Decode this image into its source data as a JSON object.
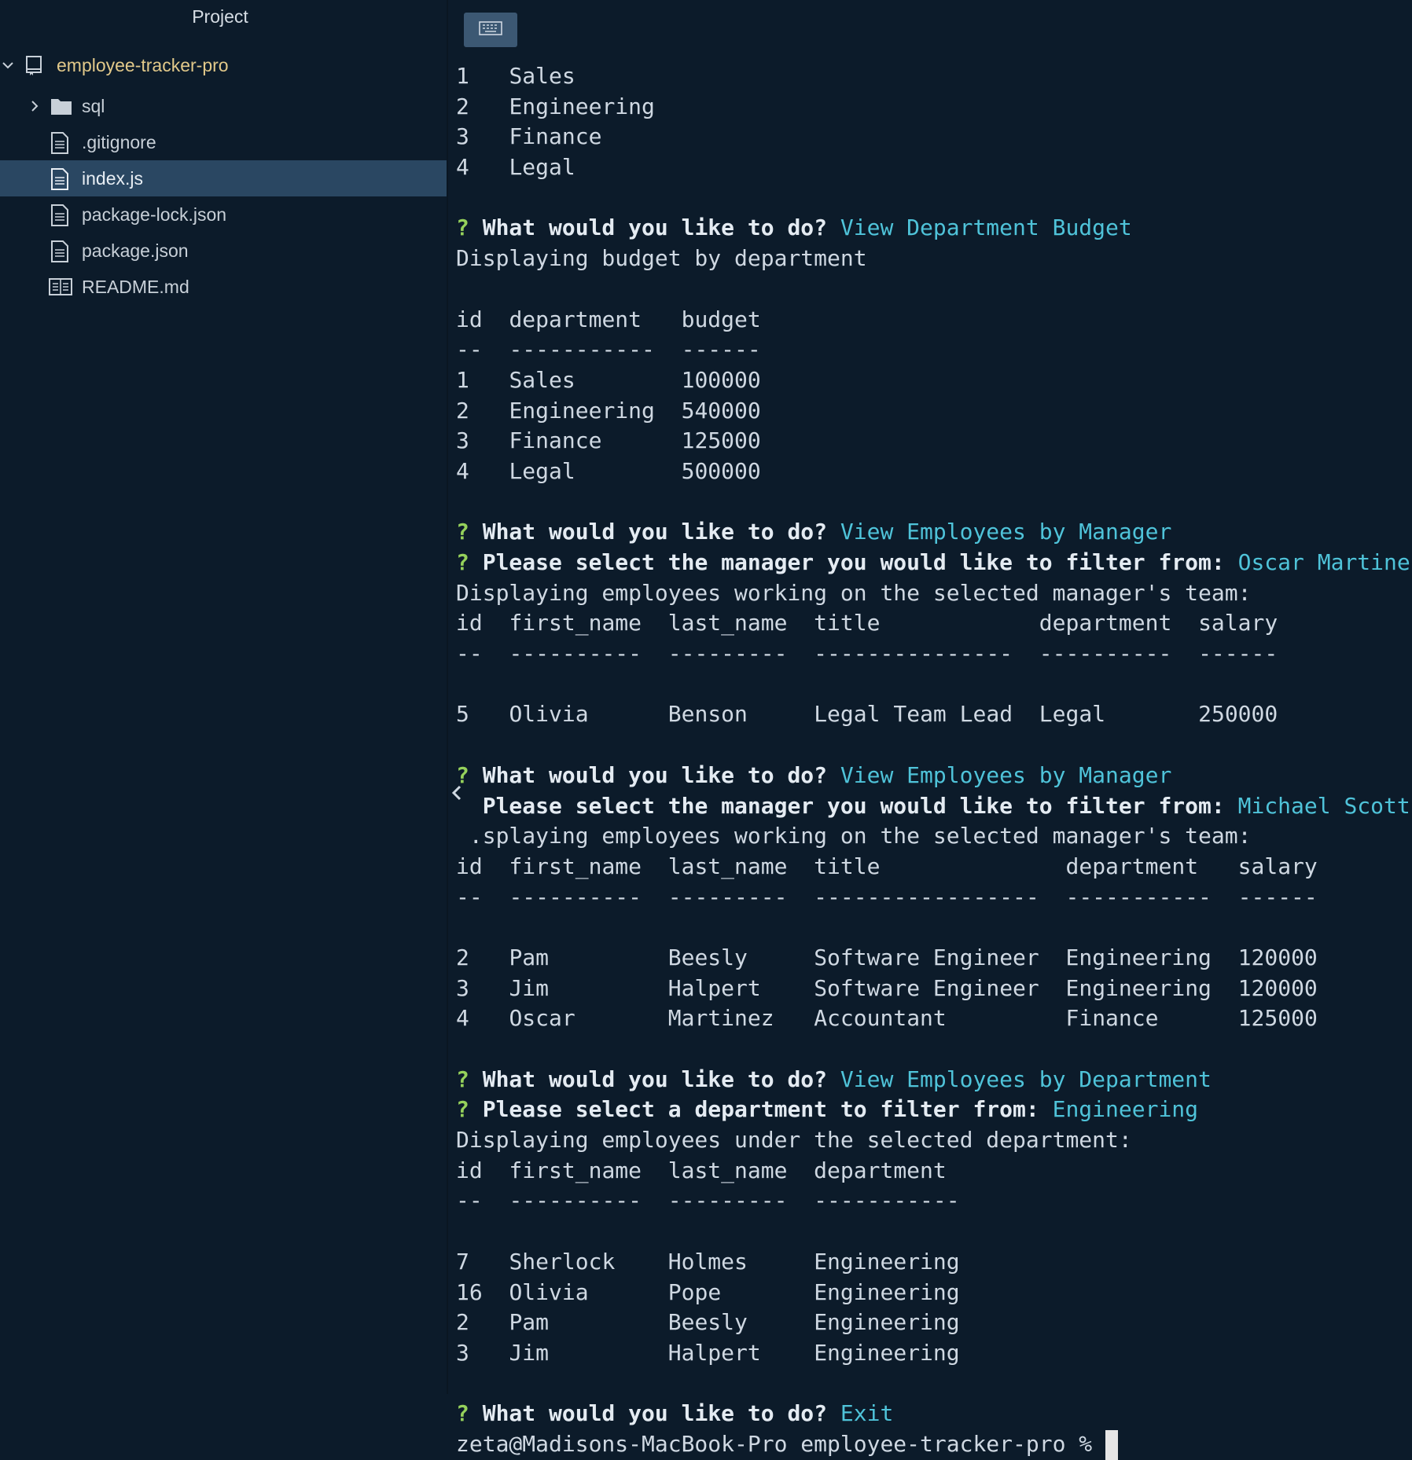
{
  "sidebar": {
    "title": "Project",
    "root": "employee-tracker-pro",
    "items": [
      {
        "label": "sql",
        "type": "folder"
      },
      {
        "label": ".gitignore",
        "type": "file"
      },
      {
        "label": "index.js",
        "type": "file",
        "selected": true
      },
      {
        "label": "package-lock.json",
        "type": "file"
      },
      {
        "label": "package.json",
        "type": "file"
      },
      {
        "label": "README.md",
        "type": "readme"
      }
    ]
  },
  "terminal": {
    "dept_list": [
      [
        "1",
        "Sales"
      ],
      [
        "2",
        "Engineering"
      ],
      [
        "3",
        "Finance"
      ],
      [
        "4",
        "Legal"
      ]
    ],
    "prompt1": {
      "q": "?",
      "text": "What would you like to do?",
      "ans": "View Department Budget"
    },
    "msg1": "Displaying budget by department",
    "budget_header": [
      "id",
      "department",
      "budget"
    ],
    "budget_dash": [
      "--",
      "-----------",
      "------"
    ],
    "budget_rows": [
      [
        "1",
        "Sales",
        "100000"
      ],
      [
        "2",
        "Engineering",
        "540000"
      ],
      [
        "3",
        "Finance",
        "125000"
      ],
      [
        "4",
        "Legal",
        "500000"
      ]
    ],
    "prompt2": {
      "q": "?",
      "text": "What would you like to do?",
      "ans": "View Employees by Manager"
    },
    "prompt2b": {
      "q": "?",
      "text": "Please select the manager you would like to filter from:",
      "ans": "Oscar Martinez"
    },
    "msg2": "Displaying employees working on the selected manager's team:",
    "mgr1_header": [
      "id",
      "first_name",
      "last_name",
      "title",
      "department",
      "salary"
    ],
    "mgr1_dash": [
      "--",
      "----------",
      "---------",
      "---------------",
      "----------",
      "------"
    ],
    "mgr1_rows": [
      [
        "5",
        "Olivia",
        "Benson",
        "Legal Team Lead",
        "Legal",
        "250000"
      ]
    ],
    "prompt3": {
      "q": "?",
      "text": "What would you like to do?",
      "ans": "View Employees by Manager"
    },
    "prompt3b": {
      "text": "Please select the manager you would like to filter from:",
      "ans": "Michael Scott"
    },
    "msg3": ".splaying employees working on the selected manager's team:",
    "mgr2_header": [
      "id",
      "first_name",
      "last_name",
      "title",
      "department",
      "salary"
    ],
    "mgr2_dash": [
      "--",
      "----------",
      "---------",
      "-----------------",
      "-----------",
      "------"
    ],
    "mgr2_rows": [
      [
        "2",
        "Pam",
        "Beesly",
        "Software Engineer",
        "Engineering",
        "120000"
      ],
      [
        "3",
        "Jim",
        "Halpert",
        "Software Engineer",
        "Engineering",
        "120000"
      ],
      [
        "4",
        "Oscar",
        "Martinez",
        "Accountant",
        "Finance",
        "125000"
      ]
    ],
    "prompt4": {
      "q": "?",
      "text": "What would you like to do?",
      "ans": "View Employees by Department"
    },
    "prompt4b": {
      "q": "?",
      "text": "Please select a department to filter from:",
      "ans": "Engineering"
    },
    "msg4": "Displaying employees under the selected department:",
    "dept_header": [
      "id",
      "first_name",
      "last_name",
      "department"
    ],
    "dept_dash": [
      "--",
      "----------",
      "---------",
      "-----------"
    ],
    "dept_rows": [
      [
        "7",
        "Sherlock",
        "Holmes",
        "Engineering"
      ],
      [
        "16",
        "Olivia",
        "Pope",
        "Engineering"
      ],
      [
        "2",
        "Pam",
        "Beesly",
        "Engineering"
      ],
      [
        "3",
        "Jim",
        "Halpert",
        "Engineering"
      ]
    ],
    "prompt5": {
      "q": "?",
      "text": "What would you like to do?",
      "ans": "Exit"
    },
    "shell_prompt": "zeta@Madisons-MacBook-Pro employee-tracker-pro % "
  },
  "colors": {
    "background": "#0c1b2a",
    "prompt_q": "#95d15b",
    "answer": "#4fc3d9",
    "selected_row": "#2a4762",
    "root_label": "#e2c98a"
  },
  "icons": [
    "chevron-down-icon",
    "repo-icon",
    "chevron-right-icon",
    "folder-icon",
    "file-icon",
    "readme-icon",
    "keyboard-icon",
    "chevron-left-icon"
  ]
}
